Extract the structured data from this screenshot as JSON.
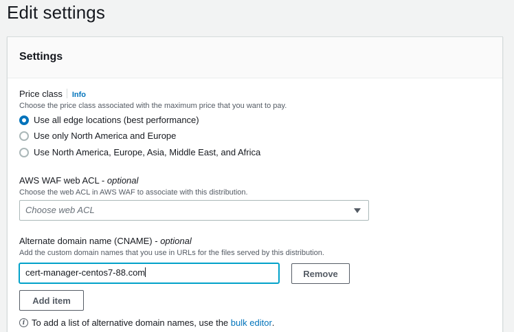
{
  "page": {
    "title": "Edit settings"
  },
  "panel": {
    "title": "Settings"
  },
  "price_class": {
    "label": "Price class",
    "info": "Info",
    "description": "Choose the price class associated with the maximum price that you want to pay.",
    "options": [
      {
        "label": "Use all edge locations (best performance)",
        "checked": true
      },
      {
        "label": "Use only North America and Europe",
        "checked": false
      },
      {
        "label": "Use North America, Europe, Asia, Middle East, and Africa",
        "checked": false
      }
    ]
  },
  "waf": {
    "label": "AWS WAF web ACL - ",
    "optional": "optional",
    "description": "Choose the web ACL in AWS WAF to associate with this distribution.",
    "placeholder": "Choose web ACL"
  },
  "cname": {
    "label": "Alternate domain name (CNAME) - ",
    "optional": "optional",
    "description": "Add the custom domain names that you use in URLs for the files served by this distribution.",
    "value": "cert-manager-centos7-88.com",
    "remove_label": "Remove",
    "add_label": "Add item",
    "hint_text": "To add a list of alternative domain names, use the ",
    "hint_link": "bulk editor",
    "hint_end": "."
  },
  "colors": {
    "accent": "#0073bb",
    "focus": "#00a1c9"
  }
}
